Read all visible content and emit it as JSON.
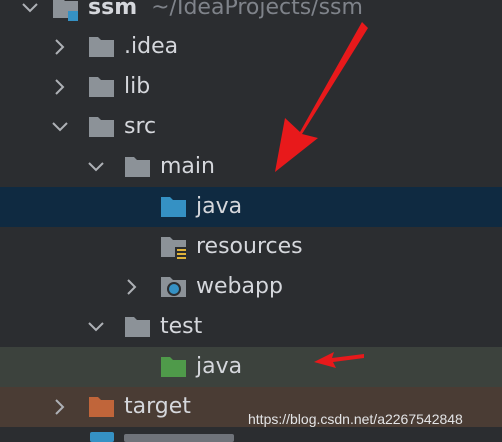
{
  "tree": {
    "root": {
      "name": "ssm",
      "path": "~/IdeaProjects/ssm"
    },
    "items": [
      {
        "label": ".idea"
      },
      {
        "label": "lib"
      },
      {
        "label": "src"
      },
      {
        "label": "main"
      },
      {
        "label": "java"
      },
      {
        "label": "resources"
      },
      {
        "label": "webapp"
      },
      {
        "label": "test"
      },
      {
        "label": "java"
      },
      {
        "label": "target"
      }
    ]
  },
  "colors": {
    "folder_gray": "#8c9298",
    "folder_source": "#3591c4",
    "folder_test": "#4f9a4a",
    "folder_excluded": "#c0653a",
    "selection_row": "#0f2a41",
    "annotation_arrow": "#e8191b"
  },
  "watermark": "https://blog.csdn.net/a2267542848"
}
